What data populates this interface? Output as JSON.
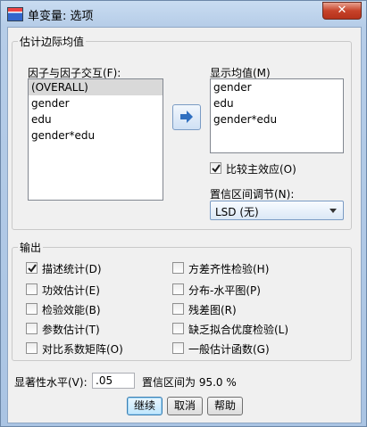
{
  "window": {
    "title": "单变量: 选项",
    "close_label": "✕"
  },
  "emm_group": {
    "title": "估计边际均值",
    "factors_label": "因子与因子交互(F):",
    "factors": [
      "(OVERALL)",
      "gender",
      "edu",
      "gender*edu"
    ],
    "selected_factor": "(OVERALL)",
    "display_label": "显示均值(M)",
    "display_items": [
      "gender",
      "edu",
      "gender*edu"
    ],
    "compare_main_label": "比较主效应(O)",
    "compare_main_checked": true,
    "ci_adjust_label": "置信区间调节(N):",
    "ci_adjust_value": "LSD (无)"
  },
  "output_group": {
    "title": "输出",
    "options": [
      {
        "label": "描述统计(D)",
        "checked": true
      },
      {
        "label": "方差齐性检验(H)",
        "checked": false
      },
      {
        "label": "功效估计(E)",
        "checked": false
      },
      {
        "label": "分布-水平图(P)",
        "checked": false
      },
      {
        "label": "检验效能(B)",
        "checked": false
      },
      {
        "label": "残差图(R)",
        "checked": false
      },
      {
        "label": "参数估计(T)",
        "checked": false
      },
      {
        "label": "缺乏拟合优度检验(L)",
        "checked": false
      },
      {
        "label": "对比系数矩阵(O)",
        "checked": false
      },
      {
        "label": "一般估计函数(G)",
        "checked": false
      }
    ]
  },
  "significance": {
    "label": "显著性水平(V):",
    "value": ".05",
    "ci_text": "置信区间为 95.0 %"
  },
  "buttons": {
    "continue": "继续",
    "cancel": "取消",
    "help": "帮助"
  }
}
